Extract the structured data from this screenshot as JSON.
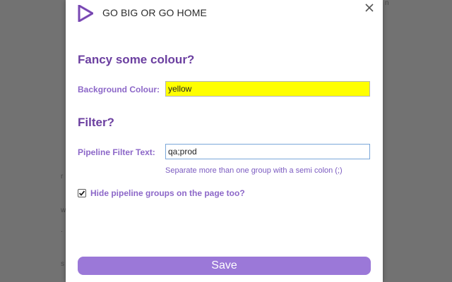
{
  "colors": {
    "accent": "#6b3fa0",
    "label": "#8c67c8",
    "button": "#9b78d8",
    "bg_input": "#ffff00",
    "logo": "#8e5cc8"
  },
  "header": {
    "title": "GO BIG OR GO HOME",
    "logo_icon": "play-triangle-logo-icon",
    "close_icon": "close-icon"
  },
  "colour_section": {
    "title": "Fancy some colour?",
    "background_label": "Background Colour:",
    "background_value": "yellow"
  },
  "filter_section": {
    "title": "Filter?",
    "filter_label": "Pipeline Filter Text:",
    "filter_value": "qa;prod",
    "helper": "Separate more than one group with a semi colon (;)",
    "hide_checkbox_checked": true,
    "hide_label": "Hide pipeline groups on the page too?"
  },
  "footer": {
    "save_label": "Save"
  }
}
